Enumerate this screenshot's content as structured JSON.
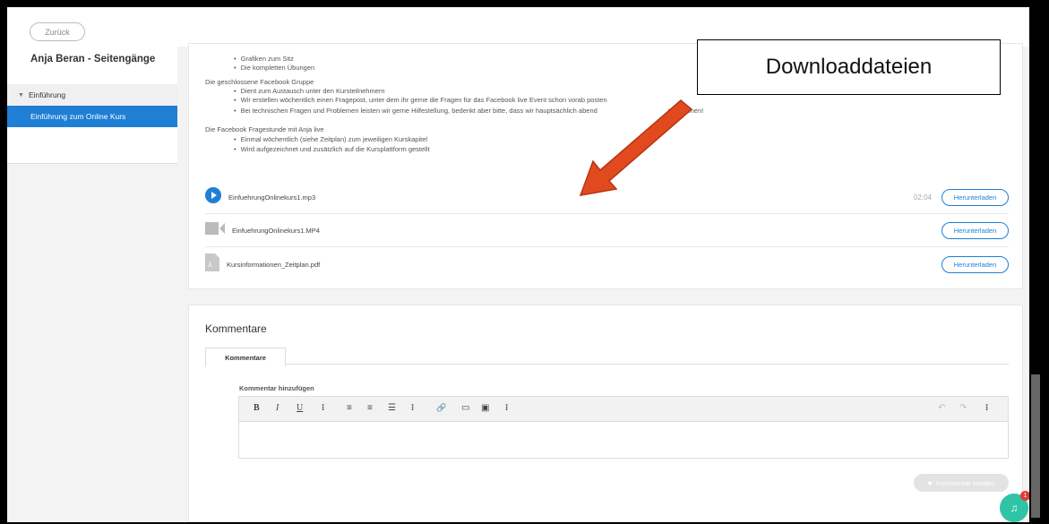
{
  "sidebar": {
    "back_label": "Zurück",
    "course_title": "Anja Beran - Seitengänge",
    "section_label": "Einführung",
    "lesson_label": "Einführung zum Online Kurs"
  },
  "content": {
    "bullets_top": [
      "Grafiken zum Sitz",
      "Die kompletten Übungen"
    ],
    "group_heading": "Die geschlossene Facebook Gruppe",
    "group_bullets": [
      "Dient zum Austausch unter den Kursteilnehmern",
      "Wir erstellen wöchentlich einen Fragepost, unter dem ihr gerne die Fragen für das Facebook live Event schon vorab posten",
      "Bei technischen Fragen und Problemen leisten wir gerne Hilfestellung, bedenkt aber bitte, dass wir hauptsächlich abend",
      "ten können!"
    ],
    "live_heading": "Die Facebook Fragestunde mit Anja live",
    "live_bullets": [
      "Einmal wöchentlich (siehe Zeitplan) zum jeweiligen Kurskapitel",
      "Wird aufgezeichnet und zusätzlich auf die Kursplattform gestellt"
    ]
  },
  "files": [
    {
      "name": "EinfuehrungOnlinekurs1.mp3",
      "duration": "02:04",
      "button": "Herunterladen",
      "icon": "audio-play-icon"
    },
    {
      "name": "EinfuehrungOnlinekurs1.MP4",
      "duration": "",
      "button": "Herunterladen",
      "icon": "video-icon"
    },
    {
      "name": "Kursinformationen_Zeitplan.pdf",
      "duration": "",
      "button": "Herunterladen",
      "icon": "pdf-icon"
    }
  ],
  "comments": {
    "title": "Kommentare",
    "tab_label": "Kommentare",
    "add_label": "Kommentar hinzufügen",
    "send_label": "Kommentar senden",
    "toolbar": [
      "B",
      "I",
      "U",
      "⁝",
      "≡",
      "≡",
      "☰",
      "⁝",
      "🔗",
      "▭",
      "▣",
      "⁝"
    ]
  },
  "annotation": {
    "label": "Downloaddateien",
    "arrow_color": "#e04a1e"
  },
  "notification": {
    "badge": "1"
  },
  "colors": {
    "accent": "#1e7fd5",
    "notif": "#2ec4a5"
  }
}
